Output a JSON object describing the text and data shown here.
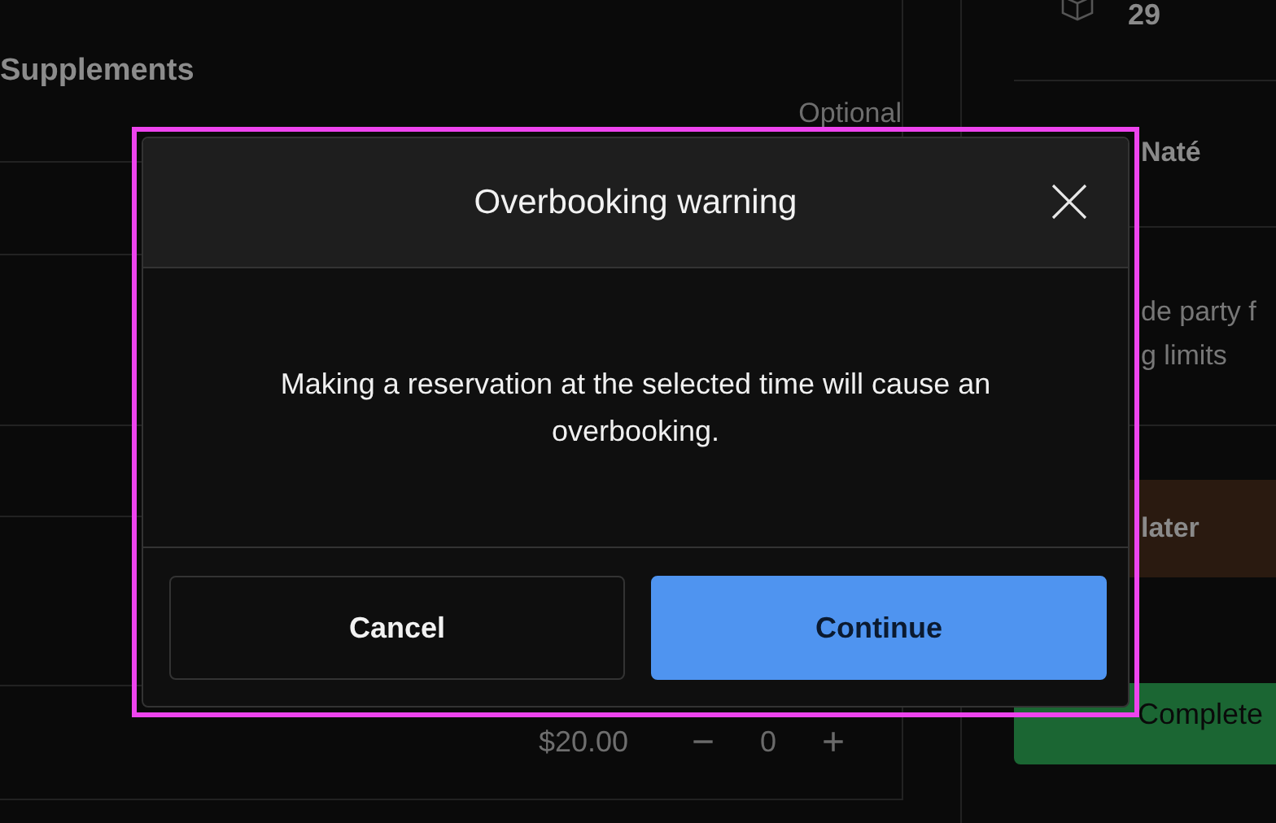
{
  "background": {
    "section_title": "Supplements",
    "optional_label": "Optional",
    "price": "$20.00",
    "decrement": "−",
    "quantity": "0",
    "increment": "+",
    "guest_count": "29",
    "guest_name": "Naté",
    "note_lines": [
      "de party f",
      "g limits"
    ],
    "later_button": "later",
    "complete_button": "Complete"
  },
  "dialog": {
    "title": "Overbooking warning",
    "message": "Making a reservation at the selected time will cause an overbooking.",
    "buttons": [
      {
        "label": "Cancel",
        "kind": "secondary"
      },
      {
        "label": "Continue",
        "kind": "primary"
      }
    ]
  }
}
